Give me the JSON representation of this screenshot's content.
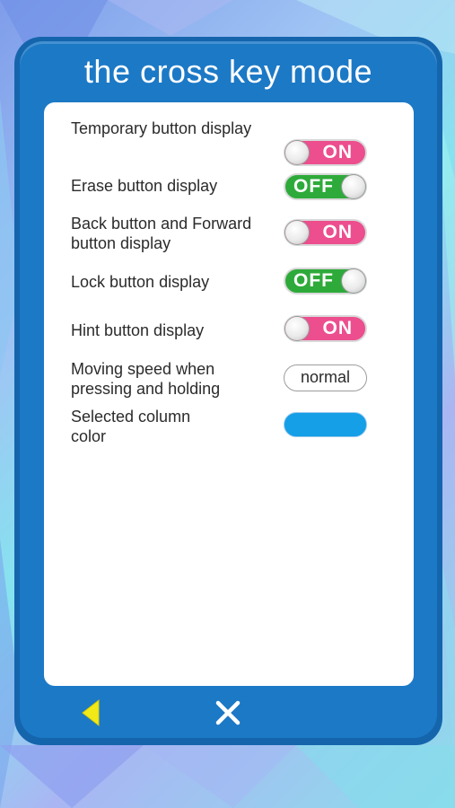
{
  "title": "the cross key mode",
  "settings": [
    {
      "label": "Temporary button display",
      "control": "toggle",
      "state": "on",
      "text": "ON"
    },
    {
      "label": "Erase button display",
      "control": "toggle",
      "state": "off",
      "text": "OFF"
    },
    {
      "label": "Back button and Forward button display",
      "control": "toggle",
      "state": "on",
      "text": "ON"
    },
    {
      "label": "Lock button display",
      "control": "toggle",
      "state": "off",
      "text": "OFF"
    },
    {
      "label": "Hint button display",
      "control": "toggle",
      "state": "on",
      "text": "ON"
    },
    {
      "label": "Moving speed when pressing and holding",
      "control": "select",
      "value": "normal"
    },
    {
      "label": "Selected column color",
      "control": "color",
      "value": "#149fe7"
    }
  ],
  "footer": {
    "back_icon": "back-triangle-icon",
    "close_icon": "close-icon"
  },
  "colors": {
    "panel": "#1c79c6",
    "toggle_on": "#ec4e8e",
    "toggle_off": "#2eaa3a",
    "back_icon": "#f2ea18",
    "selected_column": "#149fe7"
  }
}
